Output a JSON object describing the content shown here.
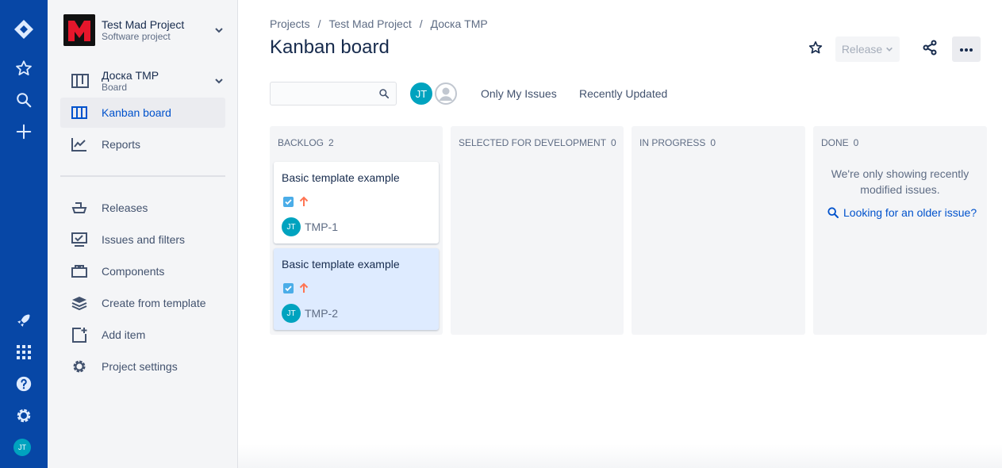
{
  "colors": {
    "global_nav": "#0747a6",
    "accent": "#0052cc",
    "avatar": "#00a3bf",
    "priority_high": "#ff7452",
    "story": "#4bade8"
  },
  "global_nav": {
    "items": [
      "jira-logo-icon",
      "star-icon",
      "search-icon",
      "create-icon"
    ],
    "bottom": [
      "rocket-icon",
      "app-switcher-icon",
      "help-icon",
      "settings-icon"
    ],
    "avatar_initials": "JT"
  },
  "sidebar": {
    "project_name": "Test Mad Project",
    "project_type": "Software project",
    "board_name": "Доска TMP",
    "board_type": "Board",
    "items": [
      {
        "label": "Kanban board",
        "icon": "board-icon"
      },
      {
        "label": "Reports",
        "icon": "reports-icon"
      },
      {
        "label": "Releases",
        "icon": "ship-icon"
      },
      {
        "label": "Issues and filters",
        "icon": "issues-icon"
      },
      {
        "label": "Components",
        "icon": "components-icon"
      },
      {
        "label": "Create from template",
        "icon": "layers-icon"
      },
      {
        "label": "Add item",
        "icon": "add-page-icon"
      },
      {
        "label": "Project settings",
        "icon": "gear-icon"
      }
    ]
  },
  "header": {
    "breadcrumbs": [
      "Projects",
      "Test Mad Project",
      "Доска TMP"
    ],
    "title": "Kanban board",
    "release_label": "Release"
  },
  "filters": {
    "search_value": "",
    "avatar_initials": "JT",
    "quick_filters": [
      "Only My Issues",
      "Recently Updated"
    ]
  },
  "board": {
    "columns": [
      {
        "title": "BACKLOG",
        "count": "2"
      },
      {
        "title": "SELECTED FOR DEVELOPMENT",
        "count": "0"
      },
      {
        "title": "IN PROGRESS",
        "count": "0"
      },
      {
        "title": "DONE",
        "count": "0"
      }
    ],
    "cards": [
      {
        "summary": "Basic template example",
        "key": "TMP-1",
        "assignee": "JT"
      },
      {
        "summary": "Basic template example",
        "key": "TMP-2",
        "assignee": "JT"
      }
    ],
    "done_message": "We're only showing recently modified issues.",
    "done_link": "Looking for an older issue?"
  }
}
